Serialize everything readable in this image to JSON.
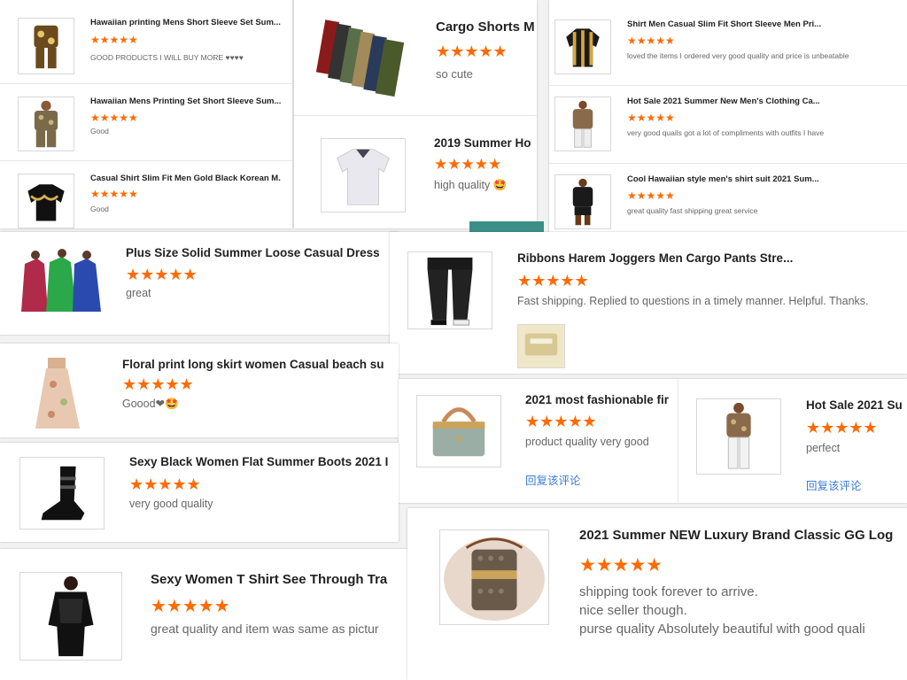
{
  "icons": {
    "star": "star-icon",
    "heart": "heart-icon",
    "emoji": "smiley-icon"
  },
  "colors": {
    "star": "#ff6a00",
    "reply": "#3a7bd5",
    "divider": "#e6e6e6"
  },
  "panel1": {
    "items": [
      {
        "title": "Hawaiian printing Mens Short Sleeve Set Sum...",
        "stars": "★★★★★",
        "text": "GOOD PRODUCTS I WILL BUY MORE ♥♥♥♥"
      },
      {
        "title": "Hawaiian Mens Printing Set Short Sleeve Sum...",
        "stars": "★★★★★",
        "text": "Good"
      },
      {
        "title": "Casual Shirt Slim Fit Men Gold Black Korean M...",
        "stars": "★★★★★",
        "text": "Good"
      }
    ]
  },
  "panel2": {
    "items": [
      {
        "title": "Cargo Shorts M",
        "stars": "★★★★★",
        "text": "so cute"
      },
      {
        "title": "2019 Summer Ho",
        "stars": "★★★★★",
        "text": "high quality 🤩"
      }
    ]
  },
  "panel3": {
    "items": [
      {
        "title": "Shirt Men Casual Slim Fit Short Sleeve Men Pri...",
        "stars": "★★★★★",
        "text": "loved the items I ordered very good quality and price is unbeatable"
      },
      {
        "title": "Hot Sale 2021 Summer New Men's Clothing Ca...",
        "stars": "★★★★★",
        "text": "very good quails got a lot of compliments with outfits I have"
      },
      {
        "title": "Cool Hawaiian style men's shirt suit 2021 Sum...",
        "stars": "★★★★★",
        "text": "great quality fast shipping great service"
      }
    ]
  },
  "p_dress": {
    "title": "Plus Size Solid Summer Loose Casual Dress",
    "stars": "★★★★★",
    "text": "great"
  },
  "p_joggers": {
    "title": "Ribbons Harem Joggers Men Cargo Pants Stre...",
    "stars": "★★★★★",
    "text": "Fast shipping. Replied to questions in a timely manner.  Helpful. Thanks."
  },
  "p_skirt": {
    "title": "Floral print long skirt women Casual beach su",
    "stars": "★★★★★",
    "text": "Goood❤🤩"
  },
  "p_bag2021": {
    "title": "2021 most fashionable fir",
    "stars": "★★★★★",
    "text": "product quality very good",
    "reply": "回复该评论"
  },
  "p_hotsale": {
    "title": "Hot Sale 2021 Su",
    "stars": "★★★★★",
    "text": "perfect",
    "reply": "回复该评论"
  },
  "p_boots": {
    "title": "Sexy Black Women Flat Summer Boots 2021 I",
    "stars": "★★★★★",
    "text": "very good quality"
  },
  "p_tshirt": {
    "title": "Sexy Women T Shirt See Through Tra",
    "stars": "★★★★★",
    "text": "great quality and item was same as pictur"
  },
  "p_luxury": {
    "title": "2021 Summer NEW Luxury Brand Classic GG Log",
    "stars": "★★★★★",
    "lines": [
      "shipping took forever to arrive.",
      "nice seller though.",
      "purse quality Absolutely beautiful with good quali"
    ]
  }
}
